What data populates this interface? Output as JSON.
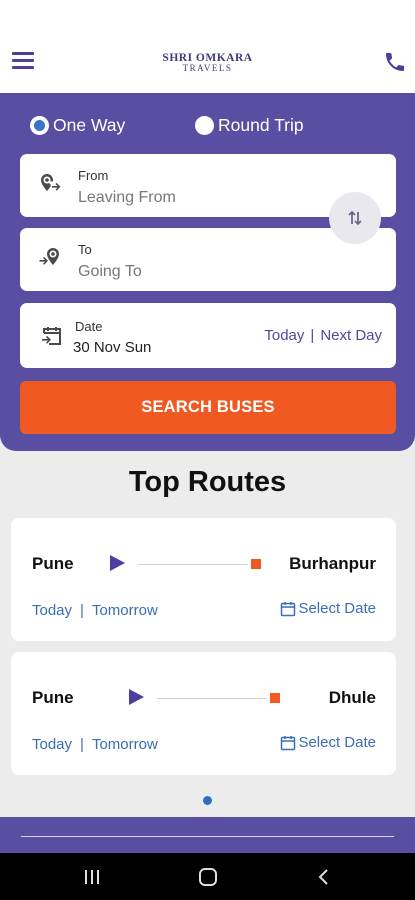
{
  "header": {
    "logo_line1": "SHRI OMKARA",
    "logo_line2": "TRAVELS",
    "menu_icon": "hamburger-menu-icon",
    "phone_icon": "phone-icon",
    "brand_color": "#5a4ea3"
  },
  "trip_type": {
    "one_way": "One Way",
    "round_trip": "Round Trip",
    "selected": "One Way"
  },
  "search": {
    "from_label": "From",
    "from_placeholder": "Leaving From",
    "to_label": "To",
    "to_placeholder": "Going To",
    "date_label": "Date",
    "date_value": "30 Nov Sun",
    "today": "Today",
    "separator": "|",
    "next_day": "Next Day",
    "button": "SEARCH BUSES",
    "button_color": "#f05a22"
  },
  "top_routes": {
    "title": "Top Routes",
    "routes": [
      {
        "from": "Pune",
        "to": "Burhanpur",
        "today": "Today",
        "separator": "|",
        "tomorrow": "Tomorrow",
        "select_date": "Select Date"
      },
      {
        "from": "Pune",
        "to": "Dhule",
        "today": "Today",
        "separator": "|",
        "tomorrow": "Tomorrow",
        "select_date": "Select Date"
      }
    ],
    "pagination_active": 1
  }
}
